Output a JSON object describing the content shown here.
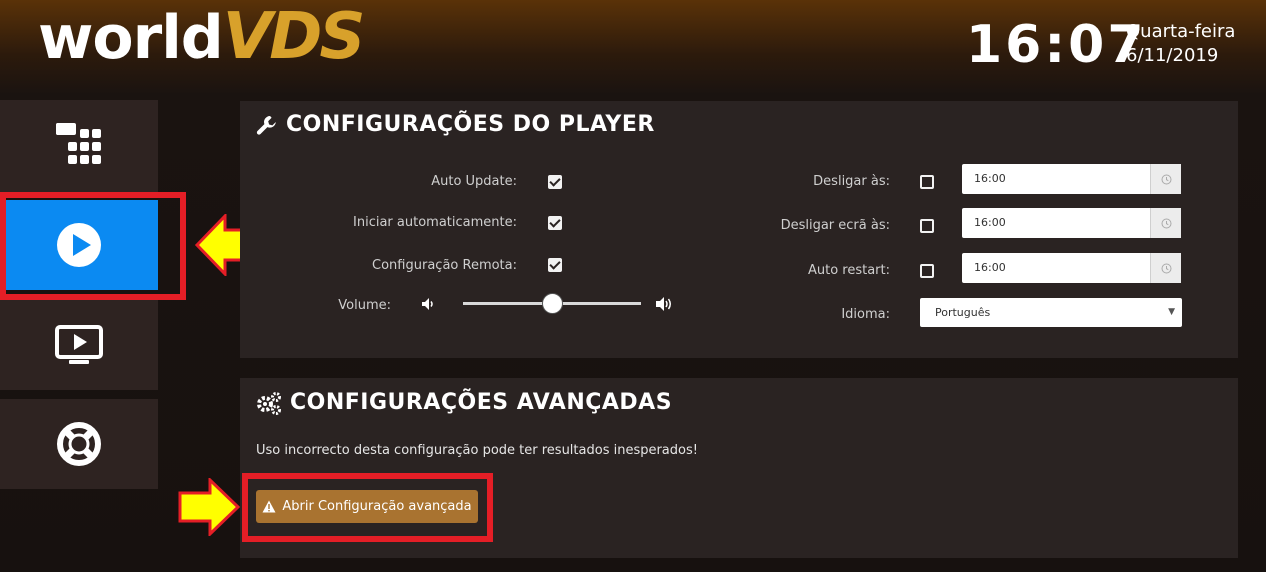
{
  "header": {
    "logo_world": "world",
    "logo_vds": "VDS",
    "time": "16:07",
    "weekday": "Quarta-feira",
    "date": "6/11/2019"
  },
  "sidebar": {
    "items": [
      {
        "name": "apps",
        "icon": "apps-grid-icon",
        "active": false
      },
      {
        "name": "player",
        "icon": "play-circle-icon",
        "active": true
      },
      {
        "name": "tv",
        "icon": "tv-play-icon",
        "active": false
      },
      {
        "name": "support",
        "icon": "lifebuoy-icon",
        "active": false
      }
    ]
  },
  "player_settings": {
    "title": "CONFIGURAÇÕES DO PLAYER",
    "icon": "wrench-icon",
    "auto_update": {
      "label": "Auto Update:",
      "checked": true
    },
    "auto_start": {
      "label": "Iniciar automaticamente:",
      "checked": true
    },
    "remote_config": {
      "label": "Configuração Remota:",
      "checked": true
    },
    "volume": {
      "label": "Volume:",
      "level": 0.5
    },
    "shutdown_at": {
      "label": "Desligar às:",
      "checked": false,
      "time": "16:00"
    },
    "screen_off_at": {
      "label": "Desligar ecrã às:",
      "checked": false,
      "time": "16:00"
    },
    "auto_restart": {
      "label": "Auto restart:",
      "checked": false,
      "time": "16:00"
    },
    "language": {
      "label": "Idioma:",
      "value": "Português"
    }
  },
  "advanced_settings": {
    "title": "CONFIGURAÇÕES AVANÇADAS",
    "icon": "gears-icon",
    "warning": "Uso incorrecto desta configuração pode ter resultados inesperados!",
    "button_label": "Abrir Configuração avançada",
    "button_icon": "warning-icon"
  },
  "colors": {
    "accent_blue": "#0b8af2",
    "highlight_red": "#e41e26",
    "arrow_yellow": "#ffff00",
    "button_brown": "#a97330",
    "logo_gold": "#d8a12b"
  }
}
